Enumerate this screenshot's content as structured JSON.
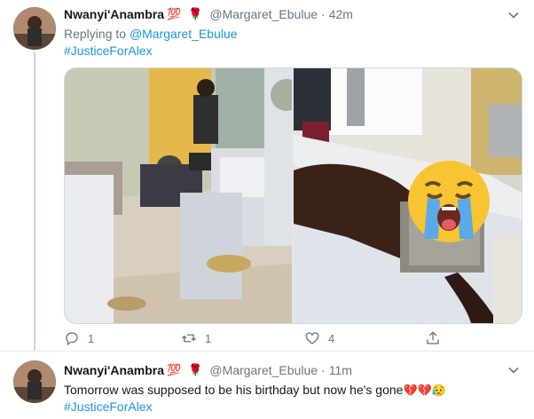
{
  "tweet1": {
    "display_name": "Nwanyi'Anambra",
    "name_emoji": "💯",
    "flower_emoji": "🌹",
    "handle": "@Margaret_Ebulue",
    "dot": "·",
    "time": "42m",
    "replying_prefix": "Replying to",
    "replying_handle": "@Margaret_Ebulue",
    "hashtag": "#JusticeForAlex",
    "media_icons": [
      "image-dental-clinic",
      "image-man-on-bed-with-crying-emoji"
    ],
    "actions": {
      "reply_count": "1",
      "retweet_count": "1",
      "like_count": "4"
    }
  },
  "tweet2": {
    "display_name": "Nwanyi'Anambra",
    "name_emoji": "💯",
    "flower_emoji": "🌹",
    "handle": "@Margaret_Ebulue",
    "dot": "·",
    "time": "11m",
    "text": "Tomorrow was supposed to be his birthday but now he's gone",
    "text_emojis": "💔💔😥",
    "hashtag": "#JusticeForAlex"
  },
  "colors": {
    "link": "#1b95e0",
    "muted": "#657786",
    "border": "#ccd6dd"
  }
}
